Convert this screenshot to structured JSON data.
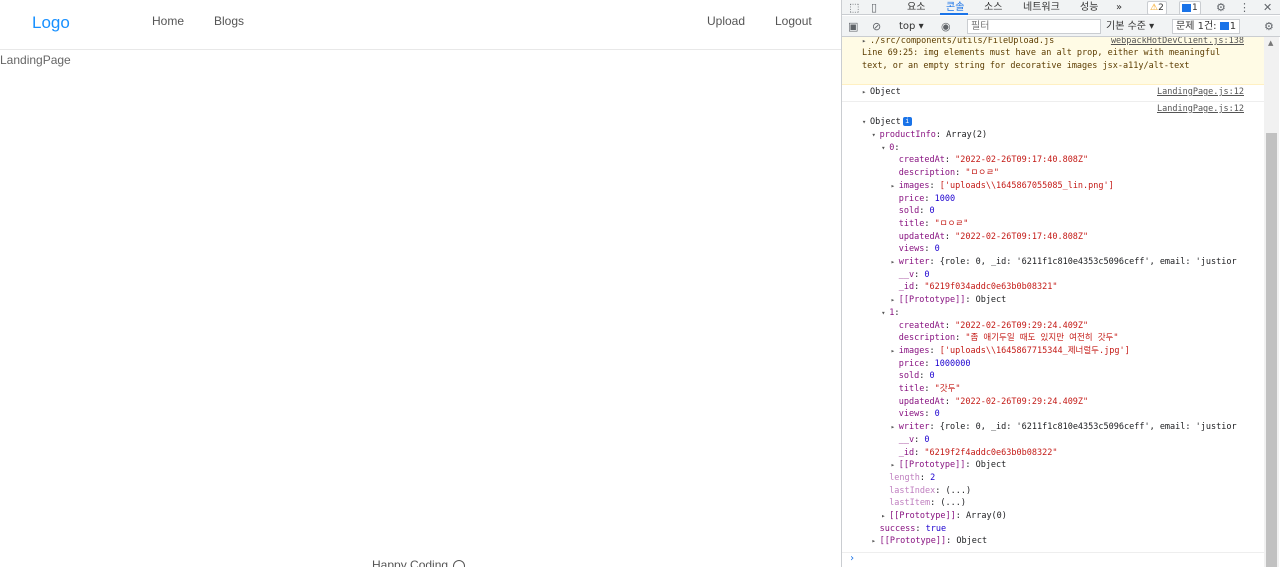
{
  "app": {
    "logo": "Logo",
    "nav_left": [
      "Home",
      "Blogs"
    ],
    "nav_right": [
      "Upload",
      "Logout"
    ],
    "page_text": "LandingPage",
    "footer": "Happy Coding"
  },
  "devtools": {
    "tabs": [
      "요소",
      "콘솔",
      "소스",
      "네트워크",
      "성능",
      "»"
    ],
    "active_tab": "콘솔",
    "warning_count": "2",
    "message_count": "1",
    "toolbar": {
      "context": "top ▾",
      "filter_placeholder": "필터",
      "levels": "기본 수준 ▾",
      "issues_label": "문제 1건:",
      "issues_count": "1"
    },
    "warning": {
      "source": "./src/components/utils/FileUpload.js",
      "text": "Line 69:25:  img elements must have an alt prop, either with meaningful text, or an empty string for decorative images  jsx-a11y/alt-text",
      "link": "webpackHotDevClient.js:138"
    },
    "log_link": "LandingPage.js:12",
    "collapsed_object": "Object",
    "expanded_object": "Object",
    "lines": [
      {
        "indent": 1,
        "tri": "▾",
        "key": "productInfo",
        "value": "Array(2)",
        "vclass": ""
      },
      {
        "indent": 2,
        "tri": "▾",
        "key": "0",
        "value": "",
        "vclass": ""
      },
      {
        "indent": 3,
        "tri": "",
        "key": "createdAt",
        "value": "\"2022-02-26T09:17:40.808Z\"",
        "vclass": "s"
      },
      {
        "indent": 3,
        "tri": "",
        "key": "description",
        "value": "\"ㅁㅇㄹ\"",
        "vclass": "s"
      },
      {
        "indent": 3,
        "tri": "▸",
        "key": "images",
        "value": "['uploads\\\\1645867055085_lin.png']",
        "vclass": "s"
      },
      {
        "indent": 3,
        "tri": "",
        "key": "price",
        "value": "1000",
        "vclass": "n"
      },
      {
        "indent": 3,
        "tri": "",
        "key": "sold",
        "value": "0",
        "vclass": "n"
      },
      {
        "indent": 3,
        "tri": "",
        "key": "title",
        "value": "\"ㅁㅇㄹ\"",
        "vclass": "s"
      },
      {
        "indent": 3,
        "tri": "",
        "key": "updatedAt",
        "value": "\"2022-02-26T09:17:40.808Z\"",
        "vclass": "s"
      },
      {
        "indent": 3,
        "tri": "",
        "key": "views",
        "value": "0",
        "vclass": "n"
      },
      {
        "indent": 3,
        "tri": "▸",
        "key": "writer",
        "value": "{role: 0, _id: '6211f1c810e4353c5096ceff', email: 'justior",
        "vclass": ""
      },
      {
        "indent": 3,
        "tri": "",
        "key": "__v",
        "value": "0",
        "vclass": "n"
      },
      {
        "indent": 3,
        "tri": "",
        "key": "_id",
        "value": "\"6219f034addc0e63b0b08321\"",
        "vclass": "s"
      },
      {
        "indent": 3,
        "tri": "▸",
        "key": "[[Prototype]]",
        "value": "Object",
        "vclass": ""
      },
      {
        "indent": 2,
        "tri": "▾",
        "key": "1",
        "value": "",
        "vclass": ""
      },
      {
        "indent": 3,
        "tri": "",
        "key": "createdAt",
        "value": "\"2022-02-26T09:29:24.409Z\"",
        "vclass": "s"
      },
      {
        "indent": 3,
        "tri": "",
        "key": "description",
        "value": "\"좀 애기두일 때도 있지만 여전히 갓두\"",
        "vclass": "s"
      },
      {
        "indent": 3,
        "tri": "▸",
        "key": "images",
        "value": "['uploads\\\\1645867715344_제너럴두.jpg']",
        "vclass": "s"
      },
      {
        "indent": 3,
        "tri": "",
        "key": "price",
        "value": "1000000",
        "vclass": "n"
      },
      {
        "indent": 3,
        "tri": "",
        "key": "sold",
        "value": "0",
        "vclass": "n"
      },
      {
        "indent": 3,
        "tri": "",
        "key": "title",
        "value": "\"갓두\"",
        "vclass": "s"
      },
      {
        "indent": 3,
        "tri": "",
        "key": "updatedAt",
        "value": "\"2022-02-26T09:29:24.409Z\"",
        "vclass": "s"
      },
      {
        "indent": 3,
        "tri": "",
        "key": "views",
        "value": "0",
        "vclass": "n"
      },
      {
        "indent": 3,
        "tri": "▸",
        "key": "writer",
        "value": "{role: 0, _id: '6211f1c810e4353c5096ceff', email: 'justior",
        "vclass": ""
      },
      {
        "indent": 3,
        "tri": "",
        "key": "__v",
        "value": "0",
        "vclass": "n"
      },
      {
        "indent": 3,
        "tri": "",
        "key": "_id",
        "value": "\"6219f2f4addc0e63b0b08322\"",
        "vclass": "s"
      },
      {
        "indent": 3,
        "tri": "▸",
        "key": "[[Prototype]]",
        "value": "Object",
        "vclass": ""
      },
      {
        "indent": 2,
        "tri": "",
        "key": "length",
        "value": "2",
        "vclass": "n",
        "dim": true
      },
      {
        "indent": 2,
        "tri": "",
        "key": "lastIndex",
        "value": "(...)",
        "vclass": "",
        "dim": true
      },
      {
        "indent": 2,
        "tri": "",
        "key": "lastItem",
        "value": "(...)",
        "vclass": "",
        "dim": true
      },
      {
        "indent": 2,
        "tri": "▸",
        "key": "[[Prototype]]",
        "value": "Array(0)",
        "vclass": ""
      },
      {
        "indent": 1,
        "tri": "",
        "key": "success",
        "value": "true",
        "vclass": "n"
      },
      {
        "indent": 1,
        "tri": "▸",
        "key": "[[Prototype]]",
        "value": "Object",
        "vclass": ""
      }
    ],
    "prompt": "›"
  }
}
